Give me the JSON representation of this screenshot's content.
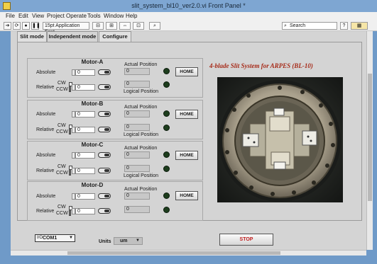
{
  "window": {
    "title": "slit_system_bl10_ver2.0.vi Front Panel *"
  },
  "menu": [
    "File",
    "Edit",
    "View",
    "Project",
    "Operate",
    "Tools",
    "Window",
    "Help"
  ],
  "toolbar": {
    "font": "15pt Application Font",
    "search_placeholder": "Search"
  },
  "tabs": [
    "Slit mode",
    "Independent mode",
    "Configure"
  ],
  "active_tab": "Independent mode",
  "motor_labels": {
    "absolute": "Absolute",
    "relative": "Relative",
    "cw": "CW",
    "ccw": "CCW",
    "actual_position": "Actual Position",
    "logical_position": "Logical Position",
    "home": "HOME"
  },
  "motors": [
    {
      "name": "Motor-A",
      "absolute": "0",
      "relative": "0",
      "actual": "0",
      "logical": "0"
    },
    {
      "name": "Motor-B",
      "absolute": "0",
      "relative": "0",
      "actual": "0",
      "logical": "0"
    },
    {
      "name": "Motor-C",
      "absolute": "0",
      "relative": "0",
      "actual": "0",
      "logical": "0"
    },
    {
      "name": "Motor-D",
      "absolute": "0",
      "relative": "0",
      "actual": "0",
      "logical": "0"
    }
  ],
  "system_title": "4-blade Slit System for ARPES (BL-10)",
  "bottom": {
    "com_port": "COM1",
    "units_label": "Units",
    "units_value": "um",
    "stop": "STOP"
  },
  "colors": {
    "title_text": "#a62a18",
    "stop_text": "#c01c1c",
    "led_off": "#1d3d1d"
  }
}
